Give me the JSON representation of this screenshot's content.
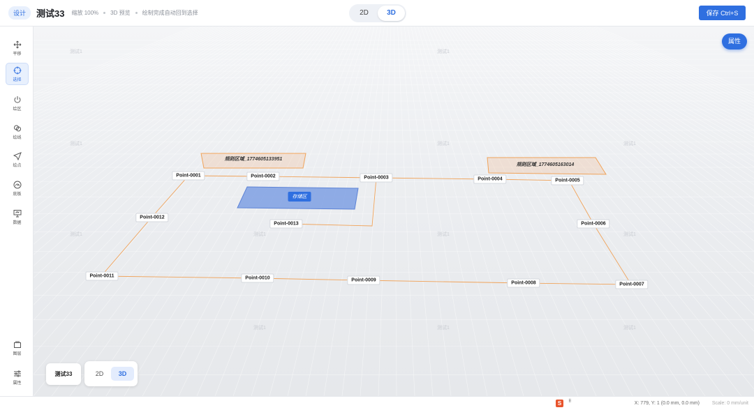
{
  "header": {
    "mode_badge": "设计",
    "project_title": "测试33",
    "zoom_text": "缩放 100%",
    "preview_text": "3D 预览",
    "hint_text": "绘制完成自动回到选择",
    "view_toggle": {
      "option_2d": "2D",
      "option_3d": "3D",
      "active": "3D"
    },
    "save_label": "保存 Ctrl+S"
  },
  "toolbar": {
    "items": [
      {
        "label": "平移",
        "icon": "move-icon",
        "active": false
      },
      {
        "label": "选择",
        "icon": "crosshair-icon",
        "active": true
      },
      {
        "label": "绘区",
        "icon": "power-icon",
        "active": false
      },
      {
        "label": "绘线",
        "icon": "link-icon",
        "active": false
      },
      {
        "label": "绘点",
        "icon": "send-icon",
        "active": false
      },
      {
        "label": "底板",
        "icon": "gauge-icon",
        "active": false
      },
      {
        "label": "数据",
        "icon": "presentation-icon",
        "active": false
      }
    ],
    "bottom_items": [
      {
        "label": "图层",
        "icon": "layers-icon"
      },
      {
        "label": "属性",
        "icon": "sliders-icon"
      }
    ]
  },
  "canvas": {
    "properties_button": "属性",
    "watermark": "测试1",
    "points": [
      {
        "name": "Point-0001"
      },
      {
        "name": "Point-0002"
      },
      {
        "name": "Point-0003"
      },
      {
        "name": "Point-0004"
      },
      {
        "name": "Point-0005"
      },
      {
        "name": "Point-0006"
      },
      {
        "name": "Point-0007"
      },
      {
        "name": "Point-0008"
      },
      {
        "name": "Point-0009"
      },
      {
        "name": "Point-0010"
      },
      {
        "name": "Point-0011"
      },
      {
        "name": "Point-0012"
      },
      {
        "name": "Point-0013"
      }
    ],
    "regions": [
      {
        "label": "规则区域_1774605133951"
      },
      {
        "label": "规则区域_1774605163014"
      }
    ],
    "storage_area_label": "存储区",
    "colors": {
      "path": "#f0a35a",
      "storage": "#7e9fe3",
      "accent": "#2f6fe0"
    }
  },
  "bottom_overlay": {
    "project_name": "测试33",
    "view_toggle": {
      "option_2d": "2D",
      "option_3d": "3D",
      "active": "3D"
    }
  },
  "statusbar": {
    "ime_icon": "S",
    "coordinates": "X: 779, Y: 1 (0.0 mm, 0.0 mm)",
    "scale": "Scale: 0 mm/unit"
  }
}
